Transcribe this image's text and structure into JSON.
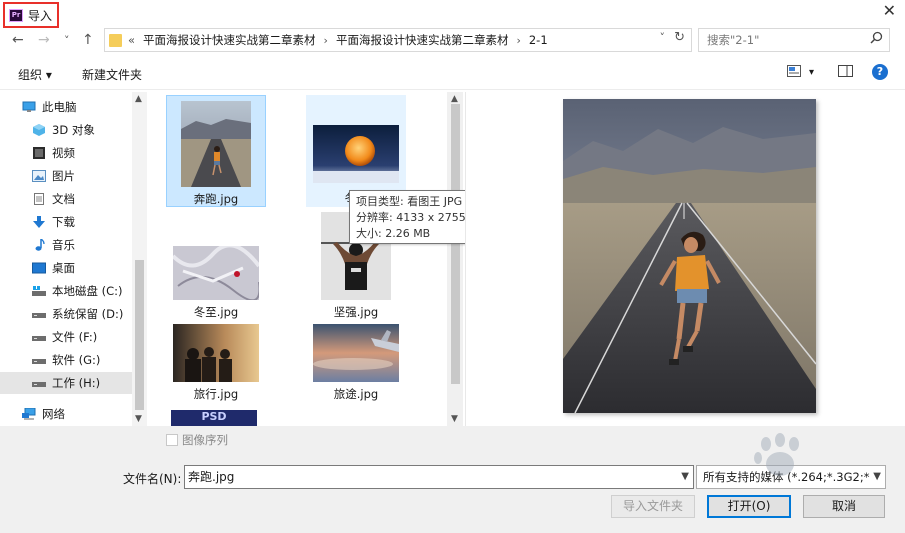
{
  "title": "导入",
  "app_logo_text": "Pr",
  "close_glyph": "✕",
  "nav": {
    "back": "←",
    "forward": "→",
    "dropdown": "˅",
    "up": "↑"
  },
  "address": {
    "overflow": "«",
    "crumbs": [
      "平面海报设计快速实战第二章素材",
      "平面海报设计快速实战第二章素材",
      "2-1"
    ],
    "separator": "›",
    "dropdown": "˅",
    "refresh": "↻"
  },
  "search": {
    "placeholder": "搜索\"2-1\"",
    "icon": "search-icon"
  },
  "toolbar": {
    "organize": "组织 ▾",
    "new_folder": "新建文件夹",
    "view_dropdown": "▾",
    "help": "?"
  },
  "sidebar": {
    "items": [
      {
        "label": "此电脑",
        "icon": "computer-icon"
      },
      {
        "label": "3D 对象",
        "icon": "cube-icon"
      },
      {
        "label": "视频",
        "icon": "video-icon"
      },
      {
        "label": "图片",
        "icon": "picture-icon"
      },
      {
        "label": "文档",
        "icon": "document-icon"
      },
      {
        "label": "下载",
        "icon": "download-icon"
      },
      {
        "label": "音乐",
        "icon": "music-icon"
      },
      {
        "label": "桌面",
        "icon": "desktop-icon"
      },
      {
        "label": "本地磁盘 (C:)",
        "icon": "drive-c-icon"
      },
      {
        "label": "系统保留 (D:)",
        "icon": "drive-icon"
      },
      {
        "label": "文件 (F:)",
        "icon": "drive-icon"
      },
      {
        "label": "软件 (G:)",
        "icon": "drive-icon"
      },
      {
        "label": "工作 (H:)",
        "icon": "drive-icon"
      },
      {
        "label": "网络",
        "icon": "network-icon"
      }
    ],
    "selected_index": 12
  },
  "files": [
    {
      "name": "奔跑.jpg",
      "state": "selected"
    },
    {
      "name": "冬天",
      "state": "hover"
    },
    {
      "name": "冬至.jpg",
      "state": "normal"
    },
    {
      "name": "坚强.jpg",
      "state": "normal"
    },
    {
      "name": "旅行.jpg",
      "state": "normal"
    },
    {
      "name": "旅途.jpg",
      "state": "normal"
    },
    {
      "name": "PSD",
      "state": "normal"
    }
  ],
  "tooltip": {
    "type": "项目类型: 看图王 JPG 图片文件",
    "resolution": "分辨率: 4133 x 2755",
    "size": "大小: 2.26 MB"
  },
  "bottom": {
    "image_sequence_label": "图像序列",
    "filename_label": "文件名(N):",
    "filename_value": "奔跑.jpg",
    "filter_value": "所有支持的媒体 (*.264;*.3G2;*",
    "import_folder_button": "导入文件夹",
    "open_button": "打开(O)",
    "cancel_button": "取消"
  },
  "colors": {
    "accent": "#0078d7",
    "selection": "#cce8ff",
    "title_highlight": "#e8302a",
    "help_blue": "#1a6fd0"
  }
}
